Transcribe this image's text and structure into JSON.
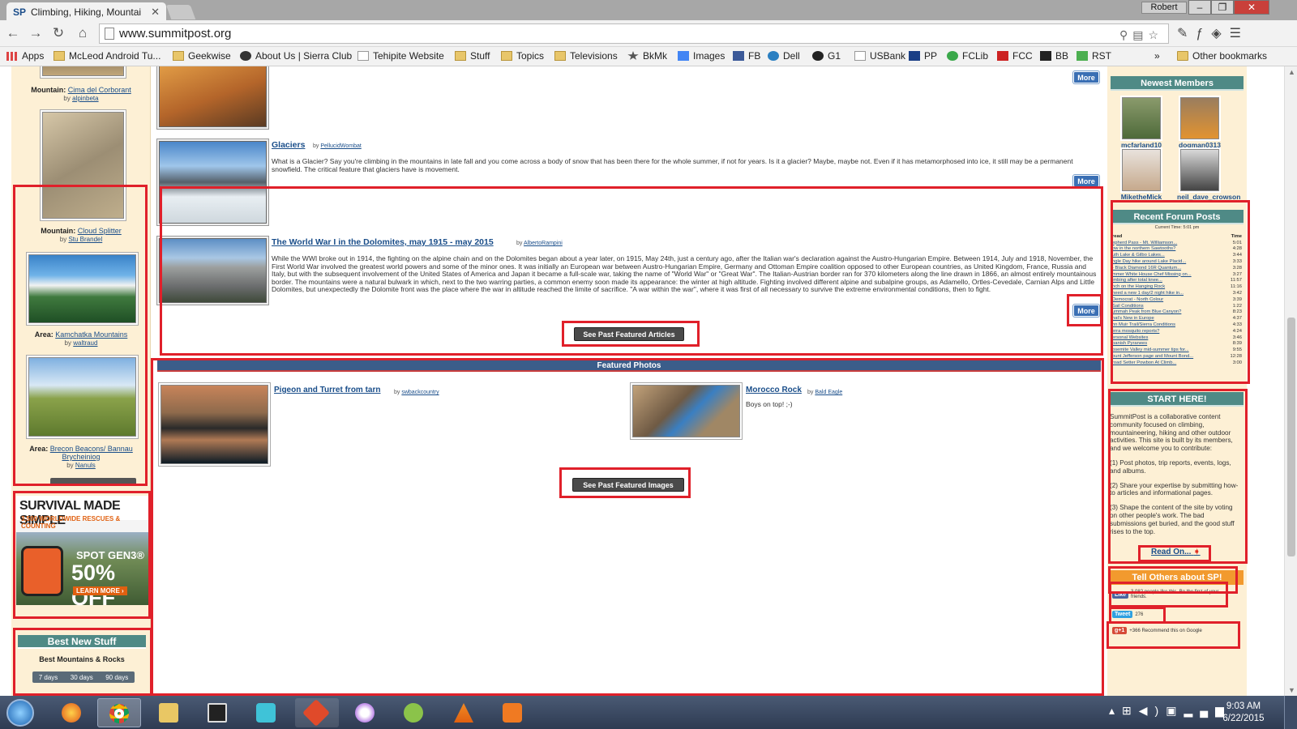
{
  "browser": {
    "tab_title": "Climbing, Hiking, Mountai",
    "tab_favicon": "SP",
    "user": "Robert",
    "url": "www.summitpost.org"
  },
  "bookmarks": [
    {
      "label": "Apps",
      "icon": "apps-grid-icon"
    },
    {
      "label": "McLeod Android Tu...",
      "icon": "folder-icon"
    },
    {
      "label": "Geekwise",
      "icon": "folder-icon"
    },
    {
      "label": "About Us | Sierra Club",
      "icon": "sierra-club-icon"
    },
    {
      "label": "Tehipite Website",
      "icon": "page-icon"
    },
    {
      "label": "Stuff",
      "icon": "folder-icon"
    },
    {
      "label": "Topics",
      "icon": "folder-icon"
    },
    {
      "label": "Televisions",
      "icon": "folder-icon"
    },
    {
      "label": "BkMk",
      "icon": "star-icon"
    },
    {
      "label": "Images",
      "icon": "google-icon"
    },
    {
      "label": "FB",
      "icon": "facebook-icon"
    },
    {
      "label": "Dell",
      "icon": "dell-icon"
    },
    {
      "label": "G1",
      "icon": "g1-icon"
    },
    {
      "label": "USBank",
      "icon": "page-icon"
    },
    {
      "label": "PP",
      "icon": "paypal-icon"
    },
    {
      "label": "FCLib",
      "icon": "fclib-icon"
    },
    {
      "label": "FCC",
      "icon": "fcc-icon"
    },
    {
      "label": "BB",
      "icon": "bb-icon"
    },
    {
      "label": "RST",
      "icon": "rst-icon"
    }
  ],
  "bookmarks_more": "»",
  "bookmarks_other": "Other bookmarks",
  "left": {
    "items": [
      {
        "kind": "Mountain:",
        "name": "Cima del Corborant",
        "by": "by",
        "author": "alpinbeta"
      },
      {
        "kind": "Mountain:",
        "name": "Cloud Splitter",
        "by": "by",
        "author": "Stu Brandel"
      },
      {
        "kind": "Area:",
        "name": "Kamchatka Mountains",
        "by": "by",
        "author": "waltraud"
      },
      {
        "kind": "Area:",
        "name": "Brecon Beacons/ Bannau Brycheiniog",
        "by": "by",
        "author": "Nanuls"
      }
    ],
    "ad": {
      "headline": "SURVIVAL MADE SIMPLE",
      "sub": "3,500 WORLDWIDE RESCUES & COUNTING",
      "product": "SPOT GEN3®",
      "offer": "50% OFF",
      "cta": "LEARN MORE ›",
      "brand": "spot"
    },
    "best_new": {
      "title": "Best New Stuff",
      "subtitle": "Best Mountains & Rocks",
      "tabs": [
        "7 days",
        "30 days",
        "90 days"
      ]
    }
  },
  "articles": [
    {
      "title": "Glaciers",
      "by": "by",
      "author": "PellucidWombat",
      "body": "What is a Glacier? Say you're climbing in the mountains in late fall and you come across a body of snow that has been there for the whole summer, if not for years. Is it a glacier? Maybe, maybe not. Even if it has metamorphosed into ice, it still may be a permanent snowfield. The critical feature that glaciers have is movement."
    },
    {
      "title": "The World War I in the Dolomites, may 1915 - may 2015",
      "by": "by",
      "author": "AlbertoRampini",
      "body": "While the WWI broke out in 1914, the fighting on the alpine chain and on the Dolomites began about a year later, on 1915, May 24th, just a century ago, after the Italian war's declaration against the Austro-Hungarian Empire. Between 1914, July and 1918, November, the First World War involved the greatest world powers and some of the minor ones. It was initially an European war between Austro-Hungarian Empire, Germany and Ottoman Empire coalition opposed to other European countries, as United Kingdom, France, Russia and Italy, but with the subsequent involvement of the United States of America and Japan it became a full-scale war, taking the name of \"World War\" or \"Great War\". The Italian-Austrian border ran for 370 kilometers along the line drawn in 1866, an almost entirely mountainous border. The mountains were a natural bulwark in which, next to the two warring parties, a common enemy soon made its appearance: the winter at high altitude. Fighting involved different alpine and subalpine groups, as Adamello, Ortles-Cevedale, Carnian Alps and Little Dolomites, but unexpectedly the Dolomite front was the place where the war in altitude reached the limite of sacrifice. \"A war within the war\", where it was first of all necessary to survive the extreme environmental conditions, then to fight."
    }
  ],
  "more_label": "More",
  "past_articles_label": "See Past Featured Articles",
  "featured_photos": {
    "heading": "Featured Photos",
    "photos": [
      {
        "title": "Pigeon and Turret from tarn",
        "by": "by",
        "author": "swbackcountry",
        "caption": ""
      },
      {
        "title": "Morocco Rock",
        "by": "by",
        "author": "Bald Eagle",
        "caption": "Boys on top! ;-)"
      }
    ],
    "past_label": "See Past Featured Images"
  },
  "right": {
    "newest_members_title": "Newest Members",
    "members": [
      "mcfarland10",
      "dogman0313",
      "MiketheMick",
      "neil_dave_crowson"
    ],
    "recent_forum_title": "Recent Forum Posts",
    "current_time": "Current Time: 5:01 pm",
    "forum_headers": [
      "read",
      "Time"
    ],
    "forum_posts": [
      {
        "t": "epherd Pass - Mt. Williamson...",
        "time": "5:01"
      },
      {
        "t": "ow in the northern Sawtooths?",
        "time": "4:28"
      },
      {
        "t": "uth Lake & Gilbo Lakes...",
        "time": "3:44"
      },
      {
        "t": "ngle Day hike around Lake Placid...",
        "time": "3:33"
      },
      {
        "t": "- Black Diamond 16R Quantum...",
        "time": "3:28"
      },
      {
        "t": "mmer White House Chef Missing on...",
        "time": "3:27"
      },
      {
        "t": "imbing after total knee...",
        "time": "11:57"
      },
      {
        "t": "nch on the Hanging Rock",
        "time": "11:16"
      },
      {
        "t": "need a new 1 day/2 night hike in...",
        "time": "3:42"
      },
      {
        "t": "Democrat - North Colour",
        "time": "3:39"
      },
      {
        "t": "Sail Conditions",
        "time": "1:22"
      },
      {
        "t": "ummah Peak from Blue Canyon?",
        "time": "8:23"
      },
      {
        "t": "hat's New in Europe",
        "time": "4:37"
      },
      {
        "t": "hn Muir Trail/Sierra Conditions",
        "time": "4:33"
      },
      {
        "t": "erra mosquito reports?",
        "time": "4:24"
      },
      {
        "t": "ersonal Websites",
        "time": "3:46"
      },
      {
        "t": "panish Pyranees",
        "time": "8:39"
      },
      {
        "t": "osemite Valley mid-summer tips for...",
        "time": "9:55"
      },
      {
        "t": "ount Jefferson page and Mount Bond...",
        "time": "12:28"
      },
      {
        "t": "road Setter Powbon At Climb...",
        "time": "3:00"
      }
    ],
    "start_title": "START HERE!",
    "start_paras": [
      "SummitPost is a collaborative content community focused on climbing, mountaineering, hiking and other outdoor activities. This site is built by its members, and we welcome you to contribute:",
      "(1) Post photos, trip reports, events, logs, and albums.",
      "(2) Share your expertise by submitting how-to articles and informational pages.",
      "(3) Shape the content of the site by voting on other people's work. The bad submissions get buried, and the good stuff rises to the top."
    ],
    "read_on": "Read On...",
    "tell_title": "Tell Others about SP!",
    "fb_like": "Like",
    "fb_text": "3,082 people like this. Be the first of your friends.",
    "tweet": "Tweet",
    "tweet_count": "276",
    "gplus": "g+1",
    "gplus_text": "+366 Recommend this on Google"
  },
  "taskbar": {
    "time": "9:03 AM",
    "date": "6/22/2015"
  },
  "colors": {
    "highlight": "#e0202a",
    "section_header": "#4f8a86",
    "page_bg": "#fdf0d5",
    "more_button": "#3a6fb4"
  }
}
